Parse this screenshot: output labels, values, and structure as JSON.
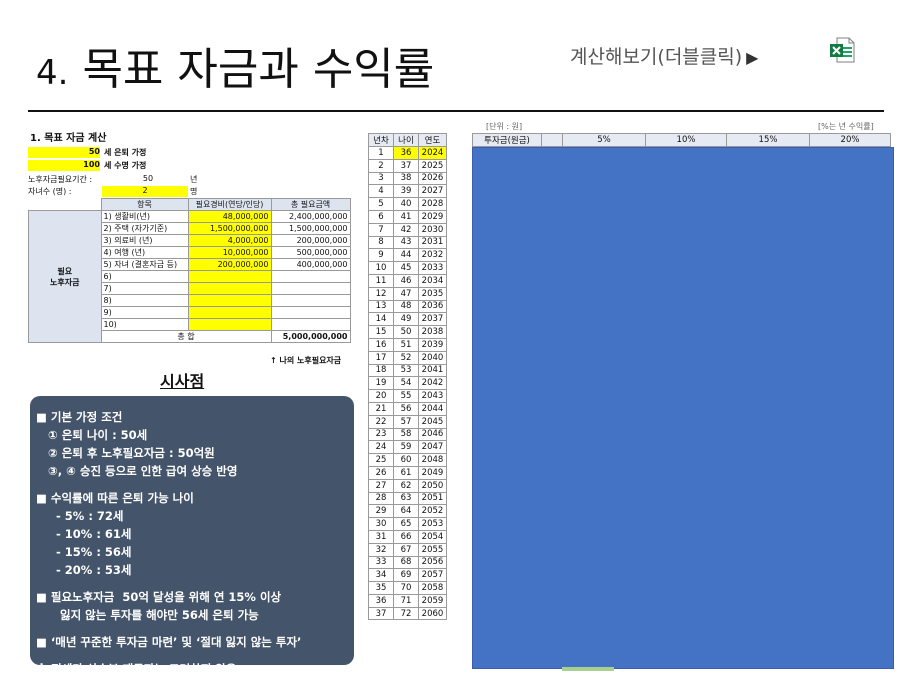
{
  "slide": {
    "title_num": "4.",
    "title_text": "목표 자금과 수익률",
    "calc_link": "계산해보기(더블클릭)",
    "calc_link_arrow": "▶",
    "excel_icon": "excel-icon"
  },
  "calc": {
    "heading": "1. 목표 자금 계산",
    "retire_age": "50",
    "retire_age_label": "세 은퇴 가정",
    "life_age": "100",
    "life_age_label": "세 수명 가정",
    "period_label": "노후자금필요기간 :",
    "period_value": "50",
    "period_unit": "년",
    "children_label": "자녀수 (명) :",
    "children_value": "2",
    "children_unit": "명",
    "headers": [
      "항목",
      "필요경비(연당/인당)",
      "총 필요금액"
    ],
    "category": "필요\n노후자금",
    "rows": [
      {
        "item": "1) 생활비(년)",
        "cost": "48,000,000",
        "total": "2,400,000,000"
      },
      {
        "item": "2) 주택 (자가기준)",
        "cost": "1,500,000,000",
        "total": "1,500,000,000"
      },
      {
        "item": "3) 의료비 (년)",
        "cost": "4,000,000",
        "total": "200,000,000"
      },
      {
        "item": "4) 여행 (년)",
        "cost": "10,000,000",
        "total": "500,000,000"
      },
      {
        "item": "5) 자녀 (결혼자금 등)",
        "cost": "200,000,000",
        "total": "400,000,000"
      },
      {
        "item": "6)",
        "cost": "",
        "total": ""
      },
      {
        "item": "7)",
        "cost": "",
        "total": ""
      },
      {
        "item": "8)",
        "cost": "",
        "total": ""
      },
      {
        "item": "9)",
        "cost": "",
        "total": ""
      },
      {
        "item": "10)",
        "cost": "",
        "total": ""
      }
    ],
    "sum_label": "총 합",
    "sum_value": "5,000,000,000",
    "note": "↑ 나의 노후필요자금"
  },
  "insight": {
    "title": "시사점",
    "lines": [
      "■ 기본 가정 조건",
      "   ① 은퇴 나이 : 50세",
      "   ② 은퇴 후 노후필요자금 : 50억원",
      "   ③, ④ 승진 등으로 인한 급여 상승 반영",
      "",
      "■ 수익률에 따른 은퇴 가능 나이",
      "     - 5% : 72세",
      "     - 10% : 61세",
      "     - 15% : 56세",
      "     - 20% : 53세",
      "",
      "■ 필요노후자금  50억 달성을 위해 연 15% 이상",
      "      잃지 않는 투자를 해야만 56세 은퇴 가능",
      "",
      "■ ‘매년 꾸준한 투자금 마련’ 및 ‘절대 잃지 않는 투자’",
      "",
      "※ 전세가 상승분 재투자는 고려하지 않음."
    ]
  },
  "table": {
    "unit_left": "[단위 : 원]",
    "unit_right": "[%는 년 수익률]",
    "headers": [
      "년차",
      "나이",
      "연도"
    ],
    "rate_headers": [
      "투자금(원금)",
      "",
      "5%",
      "10%",
      "15%",
      "20%"
    ],
    "rows": [
      [
        "1",
        "36",
        "2024"
      ],
      [
        "2",
        "37",
        "2025"
      ],
      [
        "3",
        "38",
        "2026"
      ],
      [
        "4",
        "39",
        "2027"
      ],
      [
        "5",
        "40",
        "2028"
      ],
      [
        "6",
        "41",
        "2029"
      ],
      [
        "7",
        "42",
        "2030"
      ],
      [
        "8",
        "43",
        "2031"
      ],
      [
        "9",
        "44",
        "2032"
      ],
      [
        "10",
        "45",
        "2033"
      ],
      [
        "11",
        "46",
        "2034"
      ],
      [
        "12",
        "47",
        "2035"
      ],
      [
        "13",
        "48",
        "2036"
      ],
      [
        "14",
        "49",
        "2037"
      ],
      [
        "15",
        "50",
        "2038"
      ],
      [
        "16",
        "51",
        "2039"
      ],
      [
        "17",
        "52",
        "2040"
      ],
      [
        "18",
        "53",
        "2041"
      ],
      [
        "19",
        "54",
        "2042"
      ],
      [
        "20",
        "55",
        "2043"
      ],
      [
        "21",
        "56",
        "2044"
      ],
      [
        "22",
        "57",
        "2045"
      ],
      [
        "23",
        "58",
        "2046"
      ],
      [
        "24",
        "59",
        "2047"
      ],
      [
        "25",
        "60",
        "2048"
      ],
      [
        "26",
        "61",
        "2049"
      ],
      [
        "27",
        "62",
        "2050"
      ],
      [
        "28",
        "63",
        "2051"
      ],
      [
        "29",
        "64",
        "2052"
      ],
      [
        "30",
        "65",
        "2053"
      ],
      [
        "31",
        "66",
        "2054"
      ],
      [
        "32",
        "67",
        "2055"
      ],
      [
        "33",
        "68",
        "2056"
      ],
      [
        "34",
        "69",
        "2057"
      ],
      [
        "35",
        "70",
        "2058"
      ],
      [
        "36",
        "71",
        "2059"
      ],
      [
        "37",
        "72",
        "2060"
      ]
    ],
    "colors": {
      "highlight": "#ffff00",
      "overlay": "#4472c4",
      "insight_bg": "#44546a"
    }
  }
}
